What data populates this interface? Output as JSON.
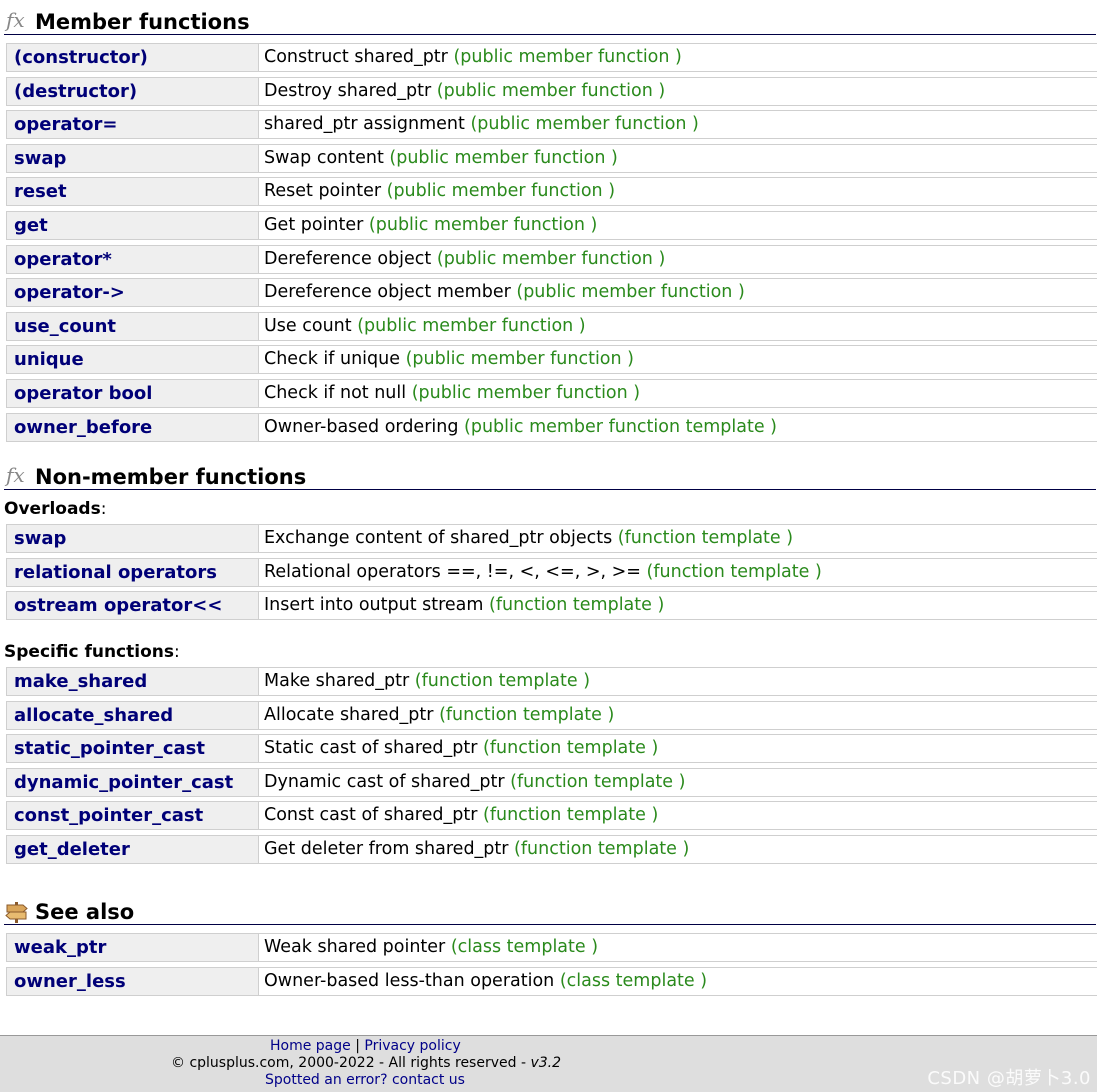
{
  "member": {
    "title": "Member functions",
    "icon": "fx-icon",
    "rows": [
      {
        "name": "(constructor)",
        "desc": "Construct shared_ptr",
        "kind": "(public member function )"
      },
      {
        "name": "(destructor)",
        "desc": "Destroy shared_ptr",
        "kind": "(public member function )"
      },
      {
        "name": "operator=",
        "desc": "shared_ptr assignment",
        "kind": "(public member function )"
      },
      {
        "name": "swap",
        "desc": "Swap content",
        "kind": "(public member function )"
      },
      {
        "name": "reset",
        "desc": "Reset pointer",
        "kind": "(public member function )"
      },
      {
        "name": "get",
        "desc": "Get pointer",
        "kind": "(public member function )"
      },
      {
        "name": "operator*",
        "desc": "Dereference object",
        "kind": "(public member function )"
      },
      {
        "name": "operator->",
        "desc": "Dereference object member",
        "kind": "(public member function )"
      },
      {
        "name": "use_count",
        "desc": "Use count",
        "kind": "(public member function )"
      },
      {
        "name": "unique",
        "desc": "Check if unique",
        "kind": "(public member function )"
      },
      {
        "name": "operator bool",
        "desc": "Check if not null",
        "kind": "(public member function )"
      },
      {
        "name": "owner_before",
        "desc": "Owner-based ordering",
        "kind": "(public member function template )"
      }
    ]
  },
  "nonmember": {
    "title": "Non-member functions",
    "icon": "fx-icon",
    "overloads_label": "Overloads",
    "overloads": [
      {
        "name": "swap",
        "desc": "Exchange content of shared_ptr objects",
        "kind": "(function template )"
      },
      {
        "name": "relational operators",
        "desc": "Relational operators ==, !=, <, <=, >, >=",
        "kind": "(function template )"
      },
      {
        "name": "ostream operator<<",
        "desc": "Insert into output stream",
        "kind": "(function template )"
      }
    ],
    "specific_label": "Specific functions",
    "specific": [
      {
        "name": "make_shared",
        "desc": "Make shared_ptr",
        "kind": "(function template )"
      },
      {
        "name": "allocate_shared",
        "desc": "Allocate shared_ptr",
        "kind": "(function template )"
      },
      {
        "name": "static_pointer_cast",
        "desc": "Static cast of shared_ptr",
        "kind": "(function template )"
      },
      {
        "name": "dynamic_pointer_cast",
        "desc": "Dynamic cast of shared_ptr",
        "kind": "(function template )"
      },
      {
        "name": "const_pointer_cast",
        "desc": "Const cast of shared_ptr",
        "kind": "(function template )"
      },
      {
        "name": "get_deleter",
        "desc": "Get deleter from shared_ptr",
        "kind": "(function template )"
      }
    ]
  },
  "seealso": {
    "title": "See also",
    "icon": "signpost-icon",
    "rows": [
      {
        "name": "weak_ptr",
        "desc": "Weak shared pointer",
        "kind": "(class template )"
      },
      {
        "name": "owner_less",
        "desc": "Owner-based less-than operation",
        "kind": "(class template )"
      }
    ]
  },
  "footer": {
    "home": "Home page",
    "sep": "|",
    "privacy": "Privacy policy",
    "copyright": "© cplusplus.com, 2000-2022 - All rights reserved -",
    "version": "v3.2",
    "spotted": "Spotted an error? contact us",
    "watermark": "CSDN @胡萝卜3.0"
  },
  "colors": {
    "name": "#000077",
    "kind": "#2a8a1c",
    "rule": "#000044",
    "footer_bg": "#dedede"
  }
}
